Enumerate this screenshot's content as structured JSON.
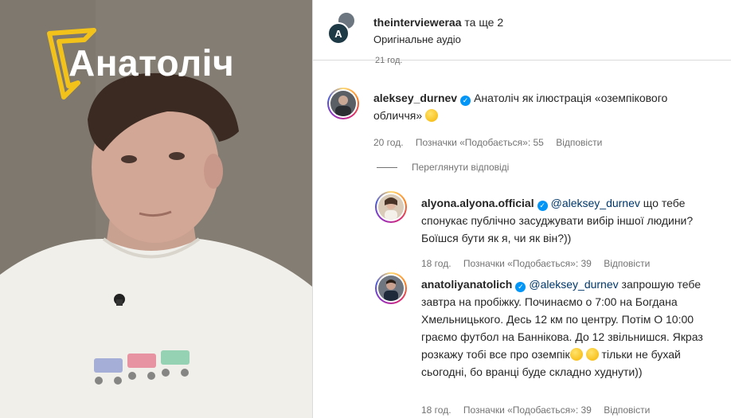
{
  "left_panel": {
    "brand_text": "Анатоліч"
  },
  "post_header": {
    "author": "theintervieweraa",
    "coauthors": "та ще 2",
    "audio": "Оригінальне аудіо",
    "avatar_letter": "A"
  },
  "cut_off_time": "21 год.",
  "comments": [
    {
      "username": "aleksey_durnev",
      "verified": true,
      "mention": "",
      "text": "Анатоліч як ілюстрація «оземпікового обличчя»",
      "time": "20 год.",
      "likes": "Позначки «Подобається»: 55",
      "reply": "Відповісти"
    }
  ],
  "view_replies": "Переглянути відповіді",
  "replies": [
    {
      "username": "alyona.alyona.official",
      "verified": true,
      "mention": "@aleksey_durnev",
      "text_line1": "що тебе",
      "text_rest": "спонукає публічно засуджувати вибір іншої людини? Боїшся бути як я, чи як він?))",
      "time": "18 год.",
      "likes": "Позначки «Подобається»: 39",
      "reply": "Відповісти"
    },
    {
      "username": "anatoliyanatolich",
      "verified": true,
      "mention": "@aleksey_durnev",
      "text_line1": "запрошую",
      "text_rest_a": "тебе завтра на пробіжку. Починаємо о 7:00 на Богдана Хмельницького. Десь 12 км по центру. Потім О 10:00 граємо футбол на Баннікова. До 12 звільнишся. Якраз розкажу тобі все про оземпік",
      "text_rest_b": "тільки не бухай сьогодні, бо вранці буде складно худнути))",
      "time": "18 год.",
      "likes": "Позначки «Подобається»: 39",
      "reply": "Відповісти"
    }
  ],
  "colors": {
    "accent_yellow": "#f2c21b",
    "verified_blue": "#0095f6",
    "mention_blue": "#00376b",
    "muted_text": "#737373"
  },
  "icons": [
    "verified-badge-icon",
    "sad-face-emoji-icon",
    "smile-emoji-icon",
    "microphone-icon"
  ]
}
